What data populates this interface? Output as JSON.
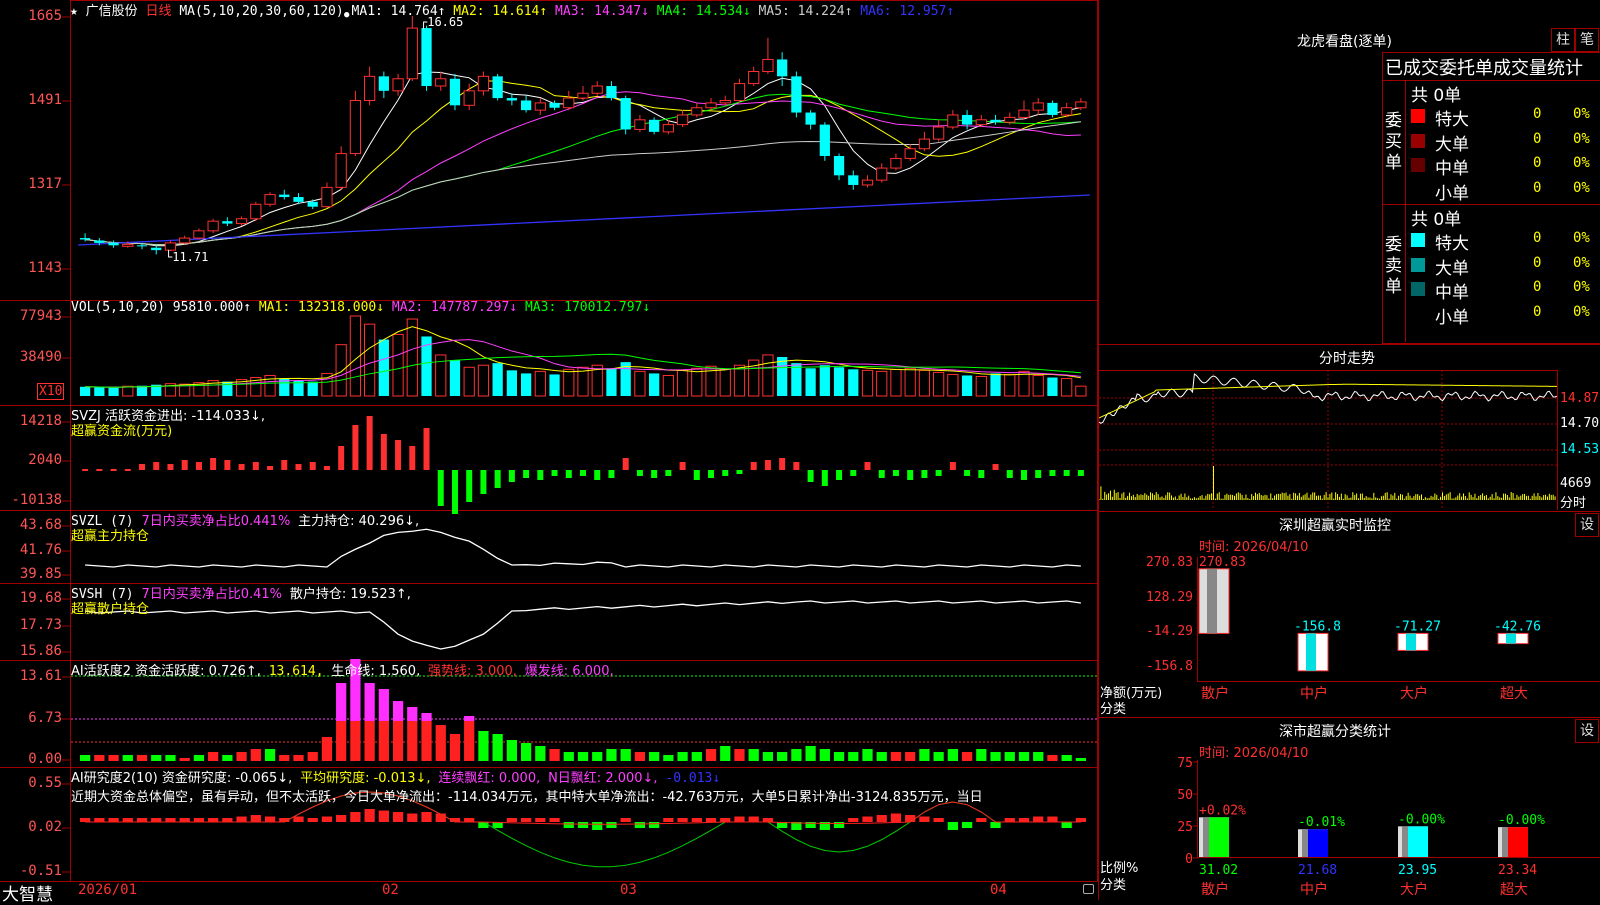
{
  "main": {
    "star": "★",
    "stock_name": "广信股份",
    "period": "日线",
    "ma_params": "MA(5,10,20,30,60,120)",
    "marker": "●",
    "ma_values": [
      {
        "label": "MA1: 14.764↑",
        "color": "#ffffff"
      },
      {
        "label": "MA2: 14.614↑",
        "color": "#ffff00"
      },
      {
        "label": "MA3: 14.347↓",
        "color": "#ff40ff"
      },
      {
        "label": "MA4: 14.534↓",
        "color": "#00ff00"
      },
      {
        "label": "MA5: 14.224↑",
        "color": "#cccccc"
      },
      {
        "label": "MA6: 12.957↑",
        "color": "#3333ff"
      }
    ],
    "high_label": "16.65",
    "low_label": "11.71",
    "y_ticks": [
      "1665",
      "1491",
      "1317",
      "1143"
    ]
  },
  "vol": {
    "title": "VOL(5,10,20)",
    "value": "95810.000↑",
    "ma1": "MA1: 132318.000↓",
    "ma2": "MA2: 147787.297↓",
    "ma3": "MA3: 170012.797↓",
    "y_ticks": [
      "77943",
      "38490"
    ],
    "unit": "X10"
  },
  "svzj": {
    "title": "SVZJ  活跃资金进出: -114.033↓,",
    "subtitle": "超赢资金流(万元)",
    "y_ticks": [
      "14218",
      "2040",
      "-10138"
    ]
  },
  "svzl": {
    "title": "SVZL (7)",
    "ratio": "7日内买卖净占比0.441%",
    "hold": "主力持仓: 40.296↓,",
    "subtitle": "超赢主力持仓",
    "y_ticks": [
      "43.68",
      "41.76",
      "39.85"
    ]
  },
  "svsh": {
    "title": "SVSH (7)",
    "ratio": "7日内买卖净占比0.41%",
    "hold": "散户持仓: 19.523↑,",
    "subtitle": "超赢散户持仓",
    "y_ticks": [
      "19.68",
      "17.73",
      "15.86"
    ]
  },
  "ai1": {
    "title": "AI活跃度2 资金活跃度: 0.726↑,",
    "v2": "13.614,",
    "life": "生命线: 1.560,",
    "strong": "强势线: 3.000,",
    "burst": "爆发线: 6.000,",
    "y_ticks": [
      "13.61",
      "6.73",
      "0.00"
    ]
  },
  "ai2": {
    "title": "AI研究度2(10) 资金研究度: -0.065↓,",
    "avg": "平均研究度: -0.013↓,",
    "lianxu": "连续飘红: 0.000,",
    "nday": "N日飘红: 2.000↓,",
    "last": "-0.013↓",
    "desc": "近期大资金总体偏空，虽有异动，但不太活跃，今日大单净流出：-114.034万元，其中特大单净流出：-42.763万元，大单5日累计净出-3124.835万元，当日",
    "y_ticks": [
      "0.55",
      "0.02",
      "-0.51"
    ]
  },
  "xaxis": {
    "app": "大智慧",
    "dates": [
      "2026/01",
      "02",
      "03",
      "04"
    ]
  },
  "lhb": {
    "title": "龙虎看盘(逐单)",
    "btn1": "柱",
    "btn2": "笔",
    "header": "已成交委托单成交量统计",
    "buy_label": "委买单",
    "sell_label": "委卖单",
    "buy_total": "共 0单",
    "sell_total": "共 0单",
    "buy_rows": [
      {
        "name": "特大",
        "count": "0",
        "pct": "0%",
        "color": "#ff0000"
      },
      {
        "name": "大单",
        "count": "0",
        "pct": "0%",
        "color": "#990000"
      },
      {
        "name": "中单",
        "count": "0",
        "pct": "0%",
        "color": "#660000"
      },
      {
        "name": "小单",
        "count": "0",
        "pct": "0%",
        "color": "#000000"
      }
    ],
    "sell_rows": [
      {
        "name": "特大",
        "count": "0",
        "pct": "0%",
        "color": "#00ffff"
      },
      {
        "name": "大单",
        "count": "0",
        "pct": "0%",
        "color": "#009999"
      },
      {
        "name": "中单",
        "count": "0",
        "pct": "0%",
        "color": "#006666"
      },
      {
        "name": "小单",
        "count": "0",
        "pct": "0%",
        "color": "#000000"
      }
    ]
  },
  "fenshi": {
    "title": "分时走势",
    "y_ticks": [
      "14.87",
      "14.70",
      "14.53"
    ],
    "vol_tick": "4669",
    "vol_label": "分时"
  },
  "monitor": {
    "title": "深圳超赢实时监控",
    "set": "设",
    "time": "时间: 2026/04/10",
    "y_ticks": [
      "270.83",
      "128.29",
      "-14.29",
      "-156.8"
    ],
    "ylabel": "净额(万元)",
    "xlabel": "分类",
    "bars": [
      {
        "cat": "散户",
        "value": 270.83,
        "label": "270.83"
      },
      {
        "cat": "中户",
        "value": -156.8,
        "label": "-156.8"
      },
      {
        "cat": "大户",
        "value": -71.27,
        "label": "-71.27"
      },
      {
        "cat": "超大",
        "value": -42.76,
        "label": "-42.76"
      }
    ]
  },
  "stat": {
    "title": "深市超赢分类统计",
    "set": "设",
    "time": "时间: 2026/04/10",
    "y_ticks": [
      "75",
      "50",
      "25",
      "0"
    ],
    "ylabel": "比例%",
    "xlabel": "分类",
    "bars": [
      {
        "cat": "散户",
        "pct": 31.02,
        "label": "31.02",
        "chg": "+0.02%",
        "color": "#00ff00"
      },
      {
        "cat": "中户",
        "pct": 21.68,
        "label": "21.68",
        "chg": "-0.01%",
        "color": "#0000ff"
      },
      {
        "cat": "大户",
        "pct": 23.95,
        "label": "23.95",
        "chg": "-0.00%",
        "color": "#00ffff"
      },
      {
        "cat": "超大",
        "pct": 23.34,
        "label": "23.34",
        "chg": "-0.00%",
        "color": "#ff0000"
      }
    ]
  },
  "chart_data": [
    {
      "type": "candlestick",
      "title": "广信股份 日线",
      "x": [
        "2026/01",
        "",
        "",
        "",
        "",
        "",
        "",
        "",
        "",
        "",
        "",
        "",
        "",
        "",
        "",
        "",
        "",
        "",
        "",
        "02",
        "",
        "",
        "",
        "",
        "",
        "",
        "",
        "",
        "",
        "",
        "",
        "",
        "",
        "03",
        "",
        "",
        "",
        "",
        "",
        "",
        "",
        "",
        "",
        "",
        "",
        "",
        "",
        "",
        "",
        "",
        "",
        "",
        "",
        "",
        "",
        "",
        "",
        "",
        "",
        "",
        "",
        "",
        "",
        "",
        "",
        "",
        "04",
        "",
        "",
        "",
        ""
      ],
      "ylim": [
        11.43,
        16.65
      ],
      "series": [
        {
          "name": "K",
          "ohlc": [
            [
              12.05,
              12.02,
              12.15,
              11.98
            ],
            [
              12.0,
              11.95,
              12.05,
              11.9
            ],
            [
              11.95,
              11.9,
              12.0,
              11.85
            ],
            [
              11.88,
              11.92,
              11.98,
              11.85
            ],
            [
              11.9,
              11.88,
              11.95,
              11.82
            ],
            [
              11.85,
              11.8,
              11.9,
              11.71
            ],
            [
              11.8,
              11.95,
              12.0,
              11.78
            ],
            [
              11.95,
              12.05,
              12.1,
              11.92
            ],
            [
              12.05,
              12.2,
              12.25,
              12.02
            ],
            [
              12.2,
              12.4,
              12.45,
              12.15
            ],
            [
              12.4,
              12.35,
              12.48,
              12.3
            ],
            [
              12.35,
              12.45,
              12.5,
              12.3
            ],
            [
              12.45,
              12.75,
              12.8,
              12.4
            ],
            [
              12.75,
              12.95,
              13.0,
              12.7
            ],
            [
              12.95,
              12.9,
              13.05,
              12.85
            ],
            [
              12.9,
              12.8,
              12.98,
              12.75
            ],
            [
              12.8,
              12.7,
              12.85,
              12.65
            ],
            [
              12.7,
              13.1,
              13.2,
              12.68
            ],
            [
              13.1,
              13.8,
              13.95,
              13.05
            ],
            [
              13.8,
              14.9,
              15.1,
              13.75
            ],
            [
              14.9,
              15.4,
              15.6,
              14.8
            ],
            [
              15.4,
              15.1,
              15.5,
              14.95
            ],
            [
              15.1,
              15.35,
              15.45,
              15.0
            ],
            [
              15.35,
              16.4,
              16.65,
              15.3
            ],
            [
              16.4,
              15.2,
              16.45,
              15.1
            ],
            [
              15.2,
              15.35,
              15.5,
              15.1
            ],
            [
              15.35,
              14.8,
              15.45,
              14.7
            ],
            [
              14.8,
              15.1,
              15.25,
              14.7
            ],
            [
              15.1,
              15.4,
              15.5,
              15.0
            ],
            [
              15.4,
              14.95,
              15.45,
              14.9
            ],
            [
              14.95,
              14.9,
              15.05,
              14.8
            ],
            [
              14.9,
              14.7,
              15.0,
              14.65
            ],
            [
              14.7,
              14.85,
              14.95,
              14.6
            ],
            [
              14.85,
              14.75,
              14.9,
              14.7
            ],
            [
              14.75,
              14.95,
              15.1,
              14.7
            ],
            [
              14.95,
              15.05,
              15.2,
              14.9
            ],
            [
              15.05,
              15.2,
              15.3,
              15.0
            ],
            [
              15.2,
              14.95,
              15.3,
              14.9
            ],
            [
              14.95,
              14.3,
              15.0,
              14.2
            ],
            [
              14.3,
              14.5,
              14.6,
              14.25
            ],
            [
              14.5,
              14.25,
              14.55,
              14.2
            ],
            [
              14.25,
              14.4,
              14.5,
              14.2
            ],
            [
              14.4,
              14.6,
              14.7,
              14.35
            ],
            [
              14.6,
              14.75,
              14.85,
              14.55
            ],
            [
              14.75,
              14.85,
              14.95,
              14.7
            ],
            [
              14.85,
              14.9,
              15.0,
              14.8
            ],
            [
              14.9,
              15.25,
              15.35,
              14.85
            ],
            [
              15.25,
              15.5,
              15.6,
              15.2
            ],
            [
              15.5,
              15.75,
              16.2,
              15.45
            ],
            [
              15.75,
              15.4,
              15.9,
              15.2
            ],
            [
              15.4,
              14.65,
              15.5,
              14.55
            ],
            [
              14.65,
              14.4,
              14.7,
              14.3
            ],
            [
              14.4,
              13.75,
              14.45,
              13.65
            ],
            [
              13.75,
              13.35,
              13.8,
              13.25
            ],
            [
              13.35,
              13.15,
              13.45,
              13.05
            ],
            [
              13.15,
              13.25,
              13.35,
              13.1
            ],
            [
              13.25,
              13.5,
              13.6,
              13.2
            ],
            [
              13.5,
              13.7,
              13.8,
              13.45
            ],
            [
              13.7,
              13.9,
              14.0,
              13.65
            ],
            [
              13.9,
              14.1,
              14.25,
              13.85
            ],
            [
              14.1,
              14.35,
              14.5,
              14.05
            ],
            [
              14.35,
              14.6,
              14.7,
              14.3
            ],
            [
              14.6,
              14.4,
              14.7,
              14.3
            ],
            [
              14.4,
              14.5,
              14.6,
              14.35
            ],
            [
              14.5,
              14.45,
              14.6,
              14.4
            ],
            [
              14.45,
              14.55,
              14.65,
              14.4
            ],
            [
              14.55,
              14.7,
              14.9,
              14.5
            ],
            [
              14.7,
              14.85,
              14.95,
              14.6
            ],
            [
              14.85,
              14.6,
              14.9,
              14.55
            ],
            [
              14.6,
              14.75,
              14.85,
              14.55
            ],
            [
              14.75,
              14.87,
              14.95,
              14.7
            ]
          ]
        }
      ]
    },
    {
      "type": "bar",
      "title": "VOL(5,10,20)",
      "ylim": [
        0,
        77943
      ],
      "series": [
        {
          "name": "VOL",
          "values": [
            9000,
            8500,
            8000,
            9500,
            10000,
            11000,
            12000,
            11500,
            13000,
            15000,
            14000,
            16000,
            18000,
            20000,
            17000,
            15000,
            14000,
            22000,
            50000,
            77943,
            70000,
            55000,
            60000,
            75000,
            58000,
            40000,
            35000,
            28000,
            30000,
            32000,
            25000,
            22000,
            24000,
            21000,
            26000,
            28000,
            30000,
            27000,
            33000,
            24000,
            22000,
            20000,
            25000,
            27000,
            29000,
            26000,
            30000,
            35000,
            40000,
            38000,
            32000,
            27000,
            30000,
            28000,
            26000,
            25000,
            24000,
            26000,
            27000,
            25000,
            23000,
            21000,
            20000,
            19000,
            22000,
            21000,
            24000,
            20000,
            18000,
            17000,
            9581
          ]
        }
      ]
    }
  ]
}
